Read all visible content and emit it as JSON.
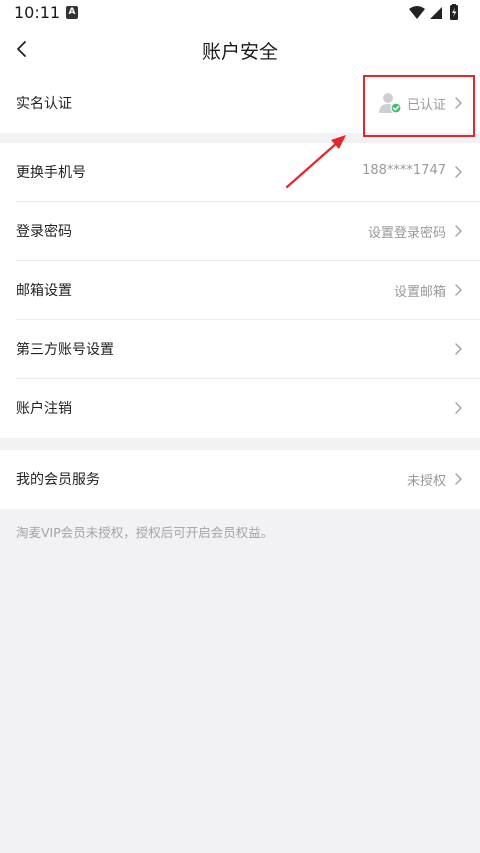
{
  "status_bar": {
    "time": "10:11",
    "app_badge": "A",
    "icons": [
      "wifi-icon",
      "cell-signal-icon",
      "battery-charging-icon"
    ]
  },
  "header": {
    "title": "账户安全",
    "back_icon": "chevron-left-icon"
  },
  "real_name": {
    "label": "实名认证",
    "value": "已认证",
    "badge_icon": "verified-user-icon",
    "badge_color": "#3cc46a"
  },
  "account_items": [
    {
      "label": "更换手机号",
      "value": "188****1747"
    },
    {
      "label": "登录密码",
      "value": "设置登录密码"
    },
    {
      "label": "邮箱设置",
      "value": "设置邮箱"
    },
    {
      "label": "第三方账号设置",
      "value": ""
    },
    {
      "label": "账户注销",
      "value": ""
    }
  ],
  "membership": {
    "label": "我的会员服务",
    "value": "未授权",
    "note": "淘麦VIP会员未授权，授权后可开启会员权益。"
  },
  "annotation": {
    "highlight_color": "#e5262a"
  }
}
